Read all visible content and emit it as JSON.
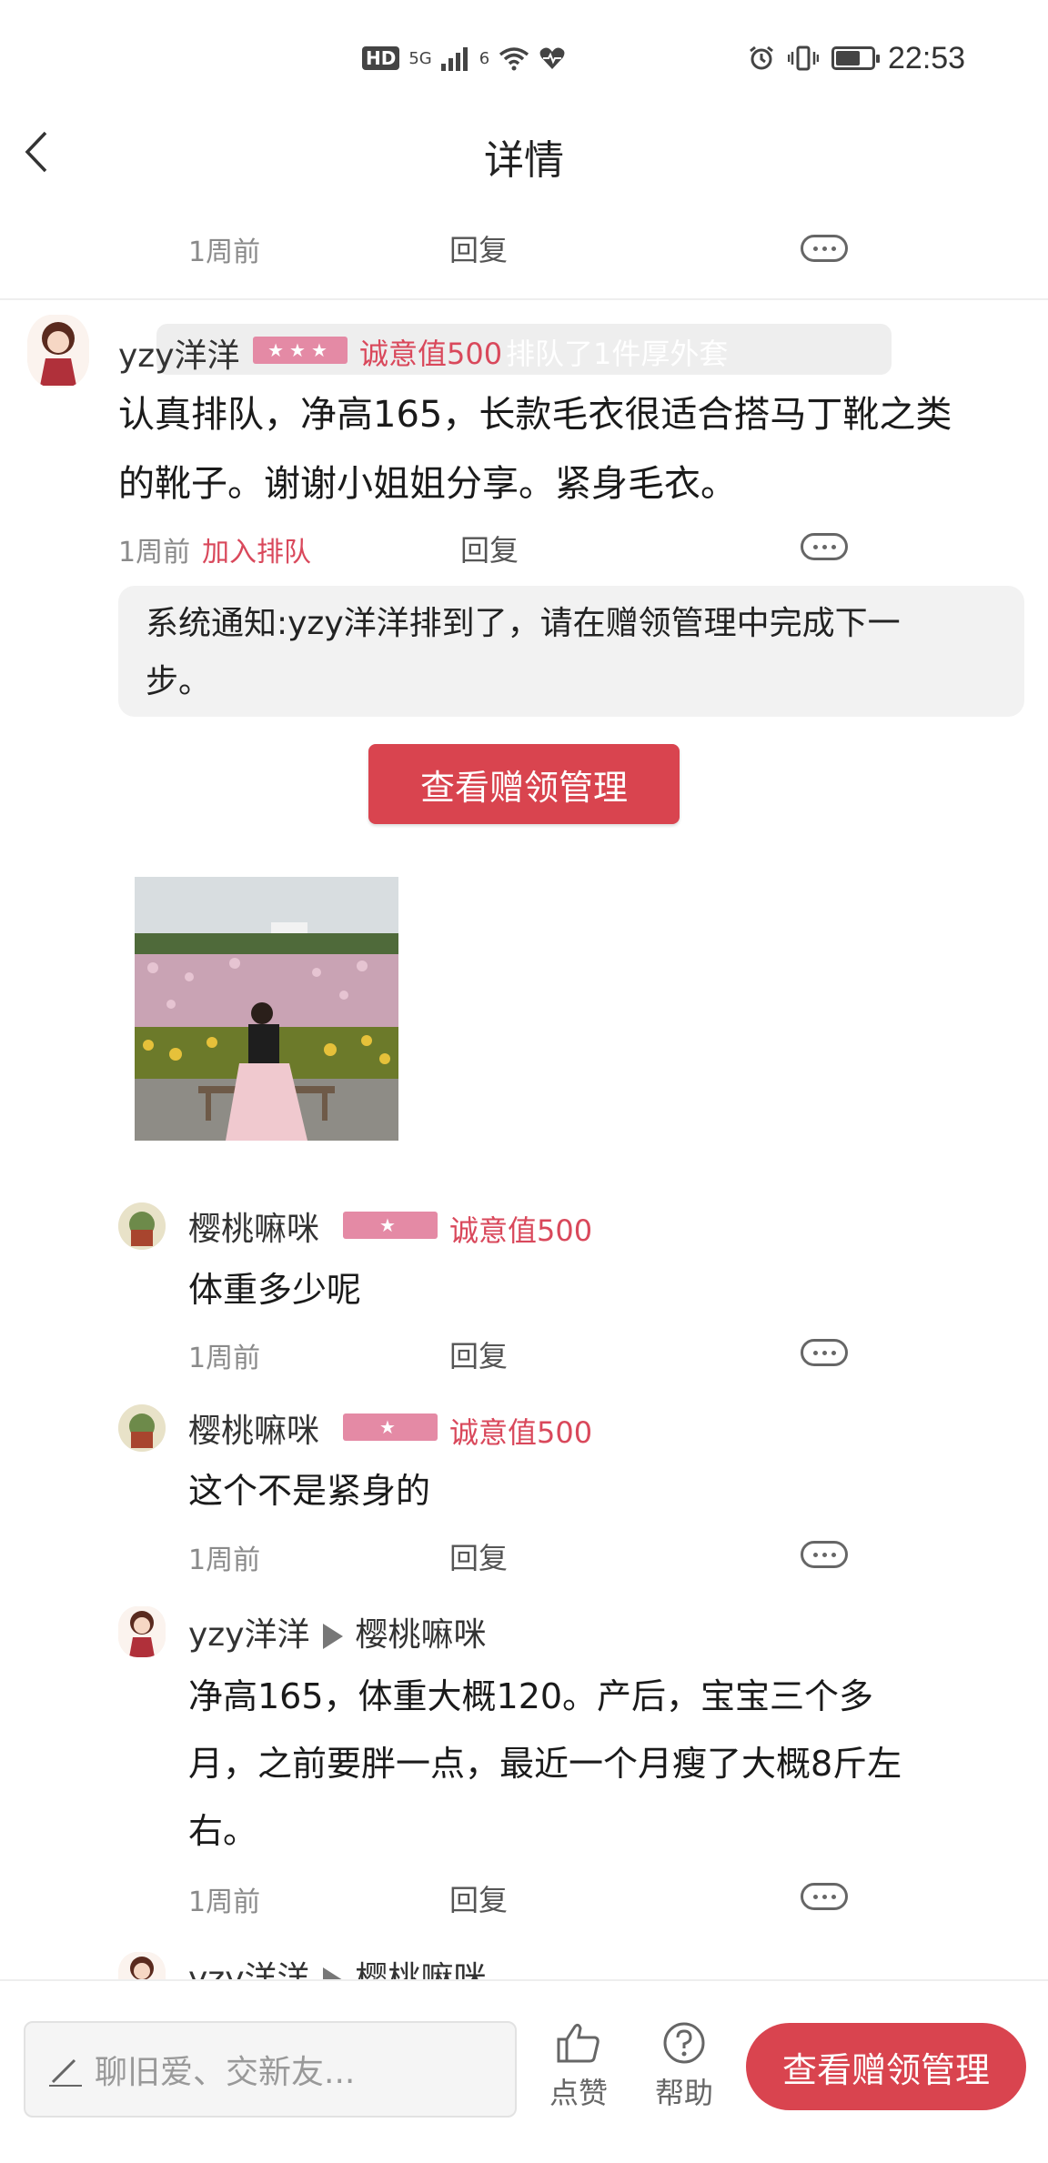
{
  "status_bar": {
    "hd_label": "HD",
    "network_label": "5G",
    "network2_label": "6",
    "time": "22:53"
  },
  "header": {
    "title": "详情"
  },
  "top_meta": {
    "time": "1周前",
    "reply": "回复"
  },
  "main_comment": {
    "username": "yzy洋洋",
    "stars": "★★★",
    "sincerity": "诚意值500",
    "overlay_text": "排队了1件厚外套",
    "text_line1": "认真排队，净高165，长款毛衣很适合搭马丁靴之类",
    "text_line2": "的靴子。谢谢小姐姐分享。紧身毛衣。",
    "time": "1周前",
    "join_queue": "加入排队",
    "reply": "回复"
  },
  "system_notice": {
    "line1": "系统通知:yzy洋洋排到了，请在赠领管理中完成下一",
    "line2": "步。",
    "button_label": "查看赠领管理"
  },
  "replies": [
    {
      "username": "樱桃嘛咪",
      "stars": "★",
      "sincerity": "诚意值500",
      "text": "体重多少呢",
      "time": "1周前",
      "reply": "回复"
    },
    {
      "username": "樱桃嘛咪",
      "stars": "★",
      "sincerity": "诚意值500",
      "text": "这个不是紧身的",
      "time": "1周前",
      "reply": "回复"
    },
    {
      "username": "yzy洋洋",
      "target": "樱桃嘛咪",
      "line1": "净高165，体重大概120。产后，宝宝三个多",
      "line2": "月，之前要胖一点，最近一个月瘦了大概8斤左",
      "line3": "右。",
      "time": "1周前",
      "reply": "回复"
    },
    {
      "username": "yzy洋洋",
      "target": "樱桃嘛咪"
    }
  ],
  "bottom_bar": {
    "input_placeholder": "聊旧爱、交新友...",
    "like_label": "点赞",
    "help_label": "帮助",
    "button_label": "查看赠领管理"
  },
  "colors": {
    "accent": "#d9444f",
    "badge": "#e48aa5",
    "sincerity": "#d9485b"
  }
}
